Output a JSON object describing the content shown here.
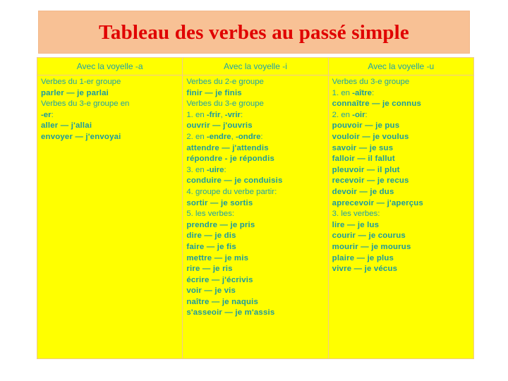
{
  "title": "Tableau des verbes au passé simple",
  "colors": {
    "title_bg": "#f8c195",
    "title_text": "#e00000",
    "table_bg": "#ffff00",
    "text": "#1fa2a8",
    "border": "#efc98f"
  },
  "table": {
    "headers": [
      "Avec la voyelle -a",
      "Avec la voyelle -i",
      "Avec la voyelle -u"
    ],
    "columns": [
      {
        "lines": [
          {
            "text": "Verbes du 1-er groupe",
            "bold": false
          },
          {
            "text": "parler — je parlai",
            "bold": true
          },
          {
            "text": "Verbes du 3-e groupe en",
            "bold": false
          },
          {
            "text": "-er:",
            "bold": false,
            "bold_part": "-er",
            "rest": ":"
          },
          {
            "text": "aller — j'allai",
            "bold": true
          },
          {
            "text": "envoyer — j'envoyai",
            "bold": true
          }
        ]
      },
      {
        "lines": [
          {
            "text": "Verbes du 2-e groupe",
            "bold": false
          },
          {
            "text": "finir — je finis",
            "bold": true
          },
          {
            "text": "Verbes du 3-e groupe",
            "bold": false
          },
          {
            "text": "1. en -frir, -vrir:",
            "bold": false
          },
          {
            "text": "ouvrir — j'ouvris",
            "bold": true
          },
          {
            "text": "2. en -endre, -ondre:",
            "bold": false
          },
          {
            "text": "attendre — j'attendis",
            "bold": true
          },
          {
            "text": "répondre - je répondis",
            "bold": true
          },
          {
            "text": "3. en -uire:",
            "bold": false
          },
          {
            "text": "conduire — je conduisis",
            "bold": true
          },
          {
            "text": "4. groupe du verbe partir:",
            "bold": false
          },
          {
            "text": "sortir — je sortis",
            "bold": true
          },
          {
            "text": "5. les verbes:",
            "bold": false
          },
          {
            "text": "prendre — je pris",
            "bold": true
          },
          {
            "text": "dire — je dis",
            "bold": true
          },
          {
            "text": "faire — je fis",
            "bold": true
          },
          {
            "text": "mettre — je mis",
            "bold": true
          },
          {
            "text": "rire — je ris",
            "bold": true
          },
          {
            "text": "écrire — j'écrivis",
            "bold": true
          },
          {
            "text": "voir — je vis",
            "bold": true
          },
          {
            "text": "naître — je naquis",
            "bold": true
          },
          {
            "text": "s'asseoir — je m'assis",
            "bold": true
          }
        ]
      },
      {
        "lines": [
          {
            "text": "Verbes du 3-e groupe",
            "bold": false
          },
          {
            "text": "1. en -aître:",
            "bold": false
          },
          {
            "text": "connaître — je connus",
            "bold": true
          },
          {
            "text": "2. en -oir:",
            "bold": false
          },
          {
            "text": "pouvoir — je pus",
            "bold": true
          },
          {
            "text": "vouloir — je voulus",
            "bold": true
          },
          {
            "text": "savoir — je sus",
            "bold": true
          },
          {
            "text": "falloir — il fallut",
            "bold": true
          },
          {
            "text": "pleuvoir — il plut",
            "bold": true
          },
          {
            "text": "recevoir — je recus",
            "bold": true
          },
          {
            "text": "devoir — je dus",
            "bold": true
          },
          {
            "text": "aprecevoir — j'aperçus",
            "bold": true
          },
          {
            "text": "3. les verbes:",
            "bold": false
          },
          {
            "text": "lire — je lus",
            "bold": true
          },
          {
            "text": "courir — je courus",
            "bold": true
          },
          {
            "text": "mourir — je mourus",
            "bold": true
          },
          {
            "text": "plaire — je plus",
            "bold": true
          },
          {
            "text": "vivre — je vécus",
            "bold": true
          }
        ]
      }
    ]
  }
}
